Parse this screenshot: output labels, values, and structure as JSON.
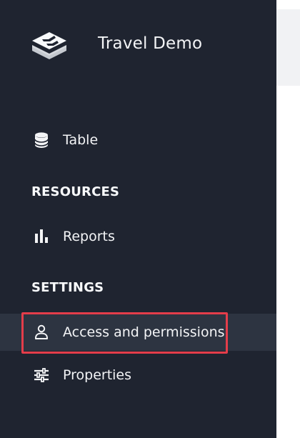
{
  "app": {
    "title": "Travel Demo",
    "logo_icon": "layered-logo-icon"
  },
  "sidebar": {
    "items": [
      {
        "label": "Table",
        "icon": "database-icon"
      }
    ],
    "sections": [
      {
        "title": "RESOURCES",
        "items": [
          {
            "label": "Reports",
            "icon": "bar-chart-icon"
          }
        ]
      },
      {
        "title": "SETTINGS",
        "items": [
          {
            "label": "Access and permissions",
            "icon": "user-icon",
            "active": true
          },
          {
            "label": "Properties",
            "icon": "sliders-icon"
          }
        ]
      }
    ]
  },
  "colors": {
    "sidebar_background": "#1f2430",
    "active_item_background": "#2d3441",
    "highlight_border": "#e43d4a",
    "text": "#f3f4f6"
  }
}
